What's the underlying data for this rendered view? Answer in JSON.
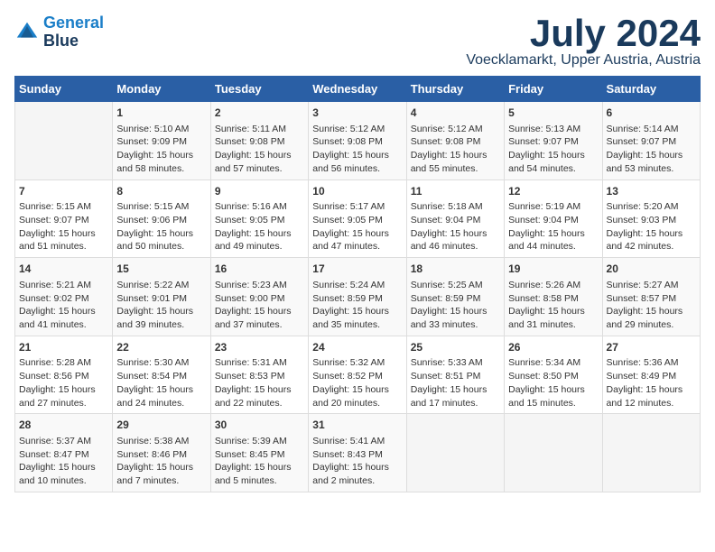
{
  "header": {
    "logo_line1": "General",
    "logo_line2": "Blue",
    "month": "July 2024",
    "location": "Voecklamarkt, Upper Austria, Austria"
  },
  "days_of_week": [
    "Sunday",
    "Monday",
    "Tuesday",
    "Wednesday",
    "Thursday",
    "Friday",
    "Saturday"
  ],
  "weeks": [
    [
      {
        "day": "",
        "info": ""
      },
      {
        "day": "1",
        "info": "Sunrise: 5:10 AM\nSunset: 9:09 PM\nDaylight: 15 hours\nand 58 minutes."
      },
      {
        "day": "2",
        "info": "Sunrise: 5:11 AM\nSunset: 9:08 PM\nDaylight: 15 hours\nand 57 minutes."
      },
      {
        "day": "3",
        "info": "Sunrise: 5:12 AM\nSunset: 9:08 PM\nDaylight: 15 hours\nand 56 minutes."
      },
      {
        "day": "4",
        "info": "Sunrise: 5:12 AM\nSunset: 9:08 PM\nDaylight: 15 hours\nand 55 minutes."
      },
      {
        "day": "5",
        "info": "Sunrise: 5:13 AM\nSunset: 9:07 PM\nDaylight: 15 hours\nand 54 minutes."
      },
      {
        "day": "6",
        "info": "Sunrise: 5:14 AM\nSunset: 9:07 PM\nDaylight: 15 hours\nand 53 minutes."
      }
    ],
    [
      {
        "day": "7",
        "info": "Sunrise: 5:15 AM\nSunset: 9:07 PM\nDaylight: 15 hours\nand 51 minutes."
      },
      {
        "day": "8",
        "info": "Sunrise: 5:15 AM\nSunset: 9:06 PM\nDaylight: 15 hours\nand 50 minutes."
      },
      {
        "day": "9",
        "info": "Sunrise: 5:16 AM\nSunset: 9:05 PM\nDaylight: 15 hours\nand 49 minutes."
      },
      {
        "day": "10",
        "info": "Sunrise: 5:17 AM\nSunset: 9:05 PM\nDaylight: 15 hours\nand 47 minutes."
      },
      {
        "day": "11",
        "info": "Sunrise: 5:18 AM\nSunset: 9:04 PM\nDaylight: 15 hours\nand 46 minutes."
      },
      {
        "day": "12",
        "info": "Sunrise: 5:19 AM\nSunset: 9:04 PM\nDaylight: 15 hours\nand 44 minutes."
      },
      {
        "day": "13",
        "info": "Sunrise: 5:20 AM\nSunset: 9:03 PM\nDaylight: 15 hours\nand 42 minutes."
      }
    ],
    [
      {
        "day": "14",
        "info": "Sunrise: 5:21 AM\nSunset: 9:02 PM\nDaylight: 15 hours\nand 41 minutes."
      },
      {
        "day": "15",
        "info": "Sunrise: 5:22 AM\nSunset: 9:01 PM\nDaylight: 15 hours\nand 39 minutes."
      },
      {
        "day": "16",
        "info": "Sunrise: 5:23 AM\nSunset: 9:00 PM\nDaylight: 15 hours\nand 37 minutes."
      },
      {
        "day": "17",
        "info": "Sunrise: 5:24 AM\nSunset: 8:59 PM\nDaylight: 15 hours\nand 35 minutes."
      },
      {
        "day": "18",
        "info": "Sunrise: 5:25 AM\nSunset: 8:59 PM\nDaylight: 15 hours\nand 33 minutes."
      },
      {
        "day": "19",
        "info": "Sunrise: 5:26 AM\nSunset: 8:58 PM\nDaylight: 15 hours\nand 31 minutes."
      },
      {
        "day": "20",
        "info": "Sunrise: 5:27 AM\nSunset: 8:57 PM\nDaylight: 15 hours\nand 29 minutes."
      }
    ],
    [
      {
        "day": "21",
        "info": "Sunrise: 5:28 AM\nSunset: 8:56 PM\nDaylight: 15 hours\nand 27 minutes."
      },
      {
        "day": "22",
        "info": "Sunrise: 5:30 AM\nSunset: 8:54 PM\nDaylight: 15 hours\nand 24 minutes."
      },
      {
        "day": "23",
        "info": "Sunrise: 5:31 AM\nSunset: 8:53 PM\nDaylight: 15 hours\nand 22 minutes."
      },
      {
        "day": "24",
        "info": "Sunrise: 5:32 AM\nSunset: 8:52 PM\nDaylight: 15 hours\nand 20 minutes."
      },
      {
        "day": "25",
        "info": "Sunrise: 5:33 AM\nSunset: 8:51 PM\nDaylight: 15 hours\nand 17 minutes."
      },
      {
        "day": "26",
        "info": "Sunrise: 5:34 AM\nSunset: 8:50 PM\nDaylight: 15 hours\nand 15 minutes."
      },
      {
        "day": "27",
        "info": "Sunrise: 5:36 AM\nSunset: 8:49 PM\nDaylight: 15 hours\nand 12 minutes."
      }
    ],
    [
      {
        "day": "28",
        "info": "Sunrise: 5:37 AM\nSunset: 8:47 PM\nDaylight: 15 hours\nand 10 minutes."
      },
      {
        "day": "29",
        "info": "Sunrise: 5:38 AM\nSunset: 8:46 PM\nDaylight: 15 hours\nand 7 minutes."
      },
      {
        "day": "30",
        "info": "Sunrise: 5:39 AM\nSunset: 8:45 PM\nDaylight: 15 hours\nand 5 minutes."
      },
      {
        "day": "31",
        "info": "Sunrise: 5:41 AM\nSunset: 8:43 PM\nDaylight: 15 hours\nand 2 minutes."
      },
      {
        "day": "",
        "info": ""
      },
      {
        "day": "",
        "info": ""
      },
      {
        "day": "",
        "info": ""
      }
    ]
  ]
}
